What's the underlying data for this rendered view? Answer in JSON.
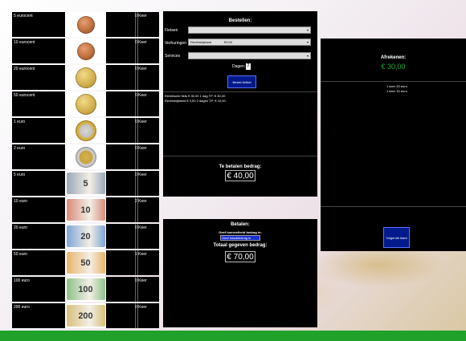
{
  "denominations": [
    {
      "label": "5 eurocent",
      "count": "0 Keer",
      "kind": "coin",
      "style": "c-copper"
    },
    {
      "label": "10 eurocent",
      "count": "0 Keer",
      "kind": "coin",
      "style": "c-copper"
    },
    {
      "label": "20 eurocent",
      "count": "0 Keer",
      "kind": "coin",
      "style": "c-gold"
    },
    {
      "label": "50 eurocent",
      "count": "0 Keer",
      "kind": "coin",
      "style": "c-gold"
    },
    {
      "label": "1 euro",
      "count": "0 Keer",
      "kind": "coin",
      "style": "c-bi"
    },
    {
      "label": "2 euro",
      "count": "0 Keer",
      "kind": "coin",
      "style": "c-bi2"
    },
    {
      "label": "5 euro",
      "count": "0 Keer",
      "kind": "note",
      "note_value": "5",
      "color": "#9aa7b8"
    },
    {
      "label": "10 euro",
      "count": "2 Keer",
      "kind": "note",
      "note_value": "10",
      "color": "#d98a7a"
    },
    {
      "label": "20 euro",
      "count": "0 Keer",
      "kind": "note",
      "note_value": "20",
      "color": "#7fa3d6"
    },
    {
      "label": "50 euro",
      "count": "1 Keer",
      "kind": "note",
      "note_value": "50",
      "color": "#e8b46a"
    },
    {
      "label": "100 euro",
      "count": "0 Keer",
      "kind": "note",
      "note_value": "100",
      "color": "#8fc08a"
    },
    {
      "label": "200 euro",
      "count": "0 Keer",
      "kind": "note",
      "note_value": "200",
      "color": "#d8c07a"
    }
  ],
  "order": {
    "title": "Bestellen:",
    "fietsen_label": "Fietsen",
    "fietsen_value": "",
    "verhuringen_label": "Verhuringen",
    "verhuringen_value": "Rechtsbijstand",
    "verhuringen_price": "€3,00",
    "services_label": "Services",
    "services_value": "",
    "dagen_label": "Dagen:",
    "dagen_value": "2",
    "order_button": "Bestel Artikel",
    "lines": [
      "Elektrische fiets € 30,00 1 dag TP: € 30,00",
      "Rechtsbijstand    € 3,00 2 dagen TP: € 10,00"
    ]
  },
  "total": {
    "title": "Te betalen bedrag:",
    "amount": "€ 40,00"
  },
  "payment": {
    "title": "Betalen:",
    "prompt": "Geef hoeveelheid bedrag in:",
    "input_placeholder": "Geef totaalbedrag in",
    "given_label": "Totaal gegeven bedrag:",
    "given_amount": "€ 70,00"
  },
  "checkout": {
    "title": "Afrekenen:",
    "amount": "€ 30,00",
    "amount_color": "#1faa3b",
    "change_lines": [
      "1 keer 20 euro",
      "1 keer 10 euro"
    ],
    "next_button": "Volgende klant"
  }
}
